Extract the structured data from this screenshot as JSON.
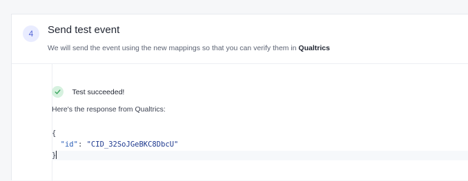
{
  "step": {
    "number": "4",
    "title": "Send test event",
    "description_prefix": "We will send the event using the new mappings so that you can verify them in ",
    "description_destination": "Qualtrics"
  },
  "result": {
    "status_text": "Test succeeded!",
    "response_label": "Here's the response from Qualtrics:",
    "status_icon": "check-icon",
    "status_color": "#3aa55d"
  },
  "code": {
    "open_brace": "{",
    "key": "\"id\"",
    "separator": ": ",
    "value": "\"CID_32SoJGeBKC8DbcU\"",
    "close_brace": "}"
  }
}
